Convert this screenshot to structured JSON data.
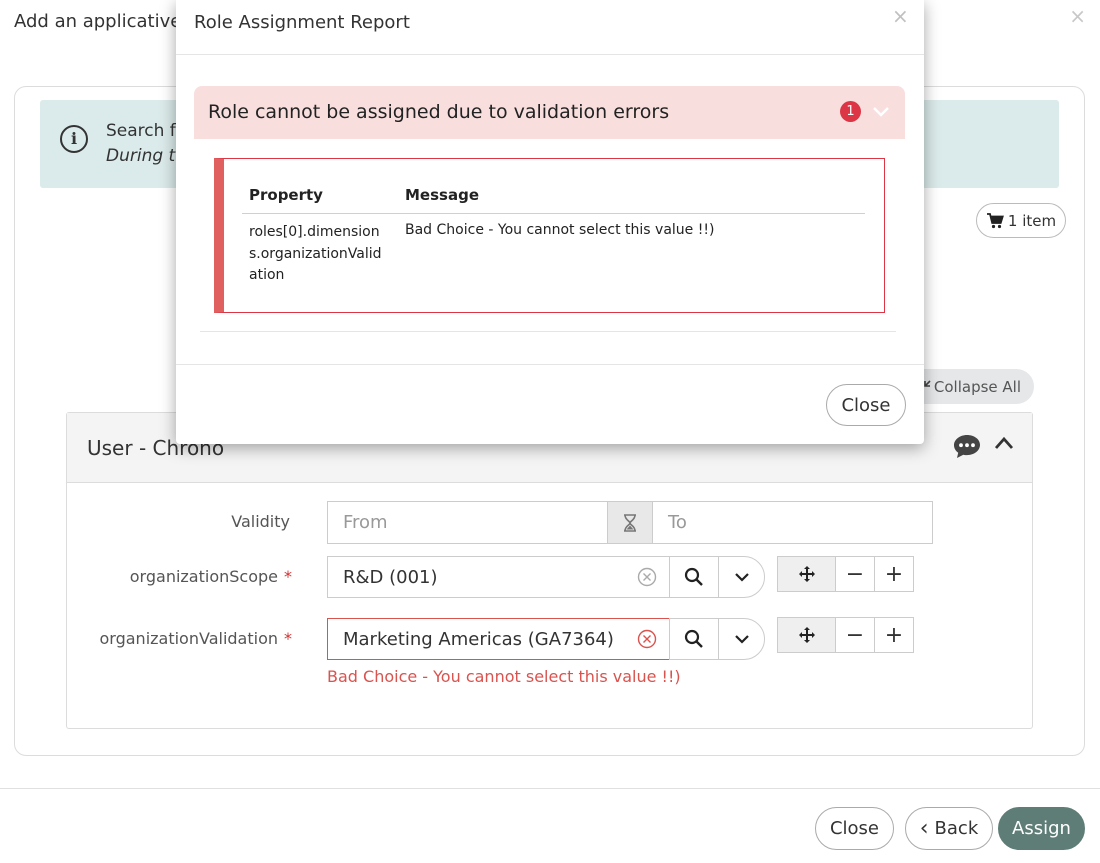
{
  "page": {
    "title": "Add an applicative r",
    "close_glyph": "×"
  },
  "banner": {
    "line1": "Search f",
    "line2": "During t",
    "info_icon_glyph": "i"
  },
  "cart": {
    "label": "1 item",
    "icon": "cart-icon"
  },
  "collapse_all": {
    "label": "Collapse All",
    "icon": "collapse-icon"
  },
  "section": {
    "title": "User - Chrono",
    "fields": {
      "validity": {
        "label": "Validity",
        "from_placeholder": "From",
        "to_placeholder": "To"
      },
      "scope": {
        "label": "organizationScope",
        "required": "*",
        "value": "R&D (001)"
      },
      "validation": {
        "label": "organizationValidation",
        "required": "*",
        "value": "Marketing Americas (GA7364)",
        "error": "Bad Choice - You cannot select this value !!)"
      }
    },
    "stepper": {
      "minus": "−",
      "plus": "+"
    }
  },
  "footer": {
    "close_label": "Close",
    "back_label": "Back",
    "back_glyph": "‹",
    "assign_label": "Assign"
  },
  "modal": {
    "title": "Role Assignment Report",
    "close_glyph": "×",
    "error_header": "Role cannot be assigned due to validation errors",
    "error_count": "1",
    "table": {
      "headers": [
        "Property",
        "Message"
      ],
      "rows": [
        {
          "property": "roles[0].dimensions.organizationValidation",
          "message": "Bad Choice - You cannot select this value !!)"
        }
      ]
    },
    "close_label": "Close"
  },
  "colors": {
    "accent": "#5e7d76",
    "error": "#d9534f",
    "error_header_bg": "#f9dede",
    "banner_bg": "#dbeaea"
  }
}
